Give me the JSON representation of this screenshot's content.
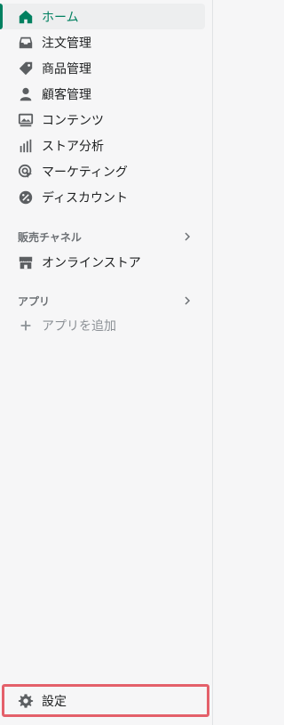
{
  "nav": {
    "items": [
      {
        "label": "ホーム",
        "icon": "home-icon",
        "active": true
      },
      {
        "label": "注文管理",
        "icon": "inbox-icon"
      },
      {
        "label": "商品管理",
        "icon": "tag-icon"
      },
      {
        "label": "顧客管理",
        "icon": "person-icon"
      },
      {
        "label": "コンテンツ",
        "icon": "image-icon"
      },
      {
        "label": "ストア分析",
        "icon": "bar-chart-icon"
      },
      {
        "label": "マーケティング",
        "icon": "target-icon"
      },
      {
        "label": "ディスカウント",
        "icon": "discount-icon"
      }
    ]
  },
  "sales_channels": {
    "title": "販売チャネル",
    "items": [
      {
        "label": "オンラインストア",
        "icon": "store-icon"
      }
    ]
  },
  "apps": {
    "title": "アプリ",
    "add_label": "アプリを追加"
  },
  "settings": {
    "label": "設定",
    "icon": "gear-icon"
  },
  "colors": {
    "accent": "#008060",
    "highlight_border": "#e4606a",
    "background": "#f6f6f7"
  }
}
